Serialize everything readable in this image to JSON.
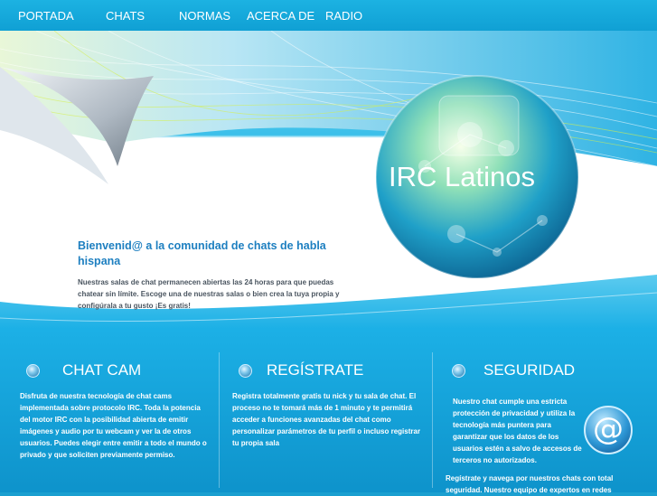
{
  "nav": {
    "items": [
      "PORTADA",
      "CHATS",
      "NORMAS",
      "ACERCA DE",
      "RADIO"
    ]
  },
  "hero": {
    "logo_text": "IRC Latinos",
    "welcome_title": "Bienvenid@ a la comunidad de chats de habla hispana",
    "welcome_text": "Nuestras salas de chat permanecen abiertas las 24 horas para que puedas chatear sin límite. Escoge una de nuestras salas o bien crea la tuya propia y configúrala a tu gusto ¡Es gratis!"
  },
  "sections": [
    {
      "title": "CHAT CAM",
      "icon": "globe-icon",
      "text": "Disfruta de nuestra tecnología de chat cams implementada sobre protocolo IRC. Toda la potencia del motor IRC con la posibilidad abierta de emitir imágenes y audio por tu webcam y ver la de otros usuarios. Puedes elegir entre emitir a todo el mundo o privado y que soliciten previamente permiso."
    },
    {
      "title": "REGÍSTRATE",
      "icon": "globe-icon",
      "text": "Registra totalmente gratis tu nick y tu sala de chat. El proceso no te tomará más de 1 minuto y te permitirá acceder a funciones avanzadas del chat como personalizar parámetros de tu perfil o incluso registrar tu propia sala"
    },
    {
      "title": "SEGURIDAD",
      "icon": "globe-icon",
      "text": "Nuestro chat cumple una estricta protección de privacidad y utiliza la tecnología más puntera para garantizar que los datos de los usuarios estén a salvo de accesos de terceros no autorizados.",
      "text2": "Regístrate y navega por nuestros chats con total seguridad. Nuestro equipo de expertos en redes"
    }
  ],
  "at_icon": "at-sign-icon",
  "colors": {
    "nav_bg": "#10a0d4",
    "title_blue": "#1d7fc0",
    "bottom_bg": "#0e93cb"
  }
}
